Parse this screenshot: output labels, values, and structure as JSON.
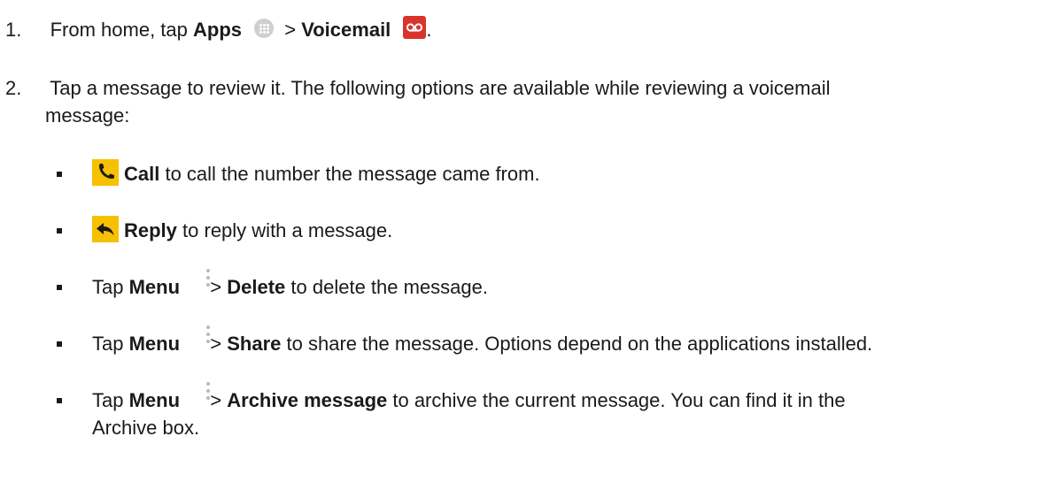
{
  "steps": [
    {
      "number": "1.",
      "pre": "From home, tap ",
      "apps_label": "Apps",
      "sep": " > ",
      "voicemail_label": "Voicemail",
      "end": "."
    },
    {
      "number": "2.",
      "line1": "Tap a message to review it. The following options are available while reviewing a voicemail",
      "line2": "message:"
    }
  ],
  "bullets": [
    {
      "bold": "Call",
      "rest": " to call the number the message came from."
    },
    {
      "bold": "Reply",
      "rest": " to reply with a message."
    },
    {
      "pre": "Tap ",
      "menu": "Menu",
      "sep": " > ",
      "bold": "Delete",
      "rest": " to delete the message."
    },
    {
      "pre": "Tap ",
      "menu": "Menu",
      "sep": " > ",
      "bold": "Share",
      "rest": " to share the message. Options depend on the applications installed."
    },
    {
      "pre": "Tap ",
      "menu": "Menu",
      "sep": " > ",
      "bold": "Archive message",
      "rest": " to archive the current message. You can find it in the",
      "line2": "Archive box."
    }
  ],
  "icons": {
    "apps": "apps-icon",
    "voicemail": "voicemail-icon",
    "call": "call-icon",
    "reply": "reply-icon",
    "menu": "menu-icon"
  },
  "colors": {
    "text": "#1a1a1a",
    "yellow": "#f7c000",
    "voicemail_red": "#d9342b",
    "apps_gray": "#cfcfcf"
  }
}
